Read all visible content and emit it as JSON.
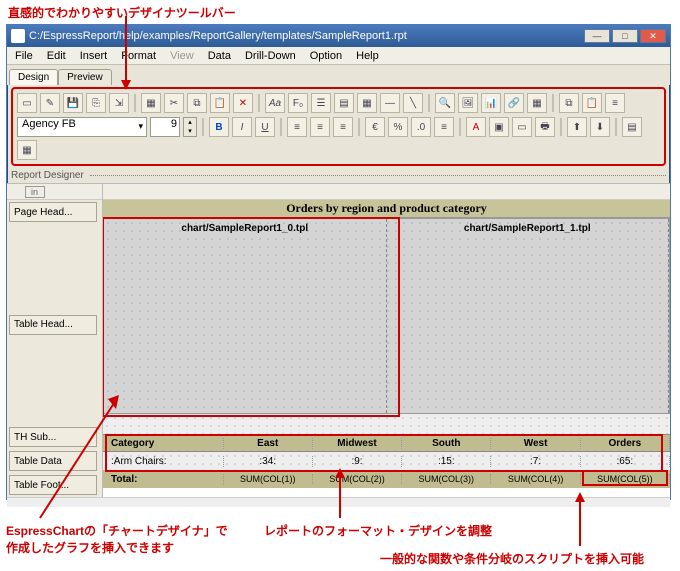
{
  "annotations": {
    "top": "直感的でわかりやすいデザイナツールバー",
    "left": "EspressChartの「チャートデザイナ」で\n作成したグラフを挿入できます",
    "center": "レポートのフォーマット・デザインを調整",
    "right": "一般的な関数や条件分岐のスクリプトを挿入可能"
  },
  "window": {
    "title": "C:/EspressReport/help/examples/ReportGallery/templates/SampleReport1.rpt"
  },
  "menu": [
    "File",
    "Edit",
    "Insert",
    "Format",
    "View",
    "Data",
    "Drill-Down",
    "Option",
    "Help"
  ],
  "tabs": [
    "Design",
    "Preview"
  ],
  "font": {
    "name": "Agency FB",
    "size": "9"
  },
  "section_label": "Report Designer",
  "ruler_unit": "in",
  "side_buttons": {
    "page_head": "Page Head...",
    "table_head": "Table Head...",
    "th_sub": "TH Sub...",
    "table_data": "Table Data",
    "table_foot": "Table Foot..."
  },
  "report": {
    "title": "Orders by region and product category",
    "chart0": "chart/SampleReport1_0.tpl",
    "chart1": "chart/SampleReport1_1.tpl",
    "columns": [
      "Category",
      "East",
      "Midwest",
      "South",
      "West",
      "Orders"
    ],
    "row": [
      ":Arm Chairs:",
      ":34:",
      ":9:",
      ":15:",
      ":7:",
      ":65:"
    ],
    "total_label": "Total:",
    "sums": [
      "SUM(COL(1))",
      "SUM(COL(2))",
      "SUM(COL(3))",
      "SUM(COL(4))",
      "SUM(COL(5))"
    ]
  }
}
